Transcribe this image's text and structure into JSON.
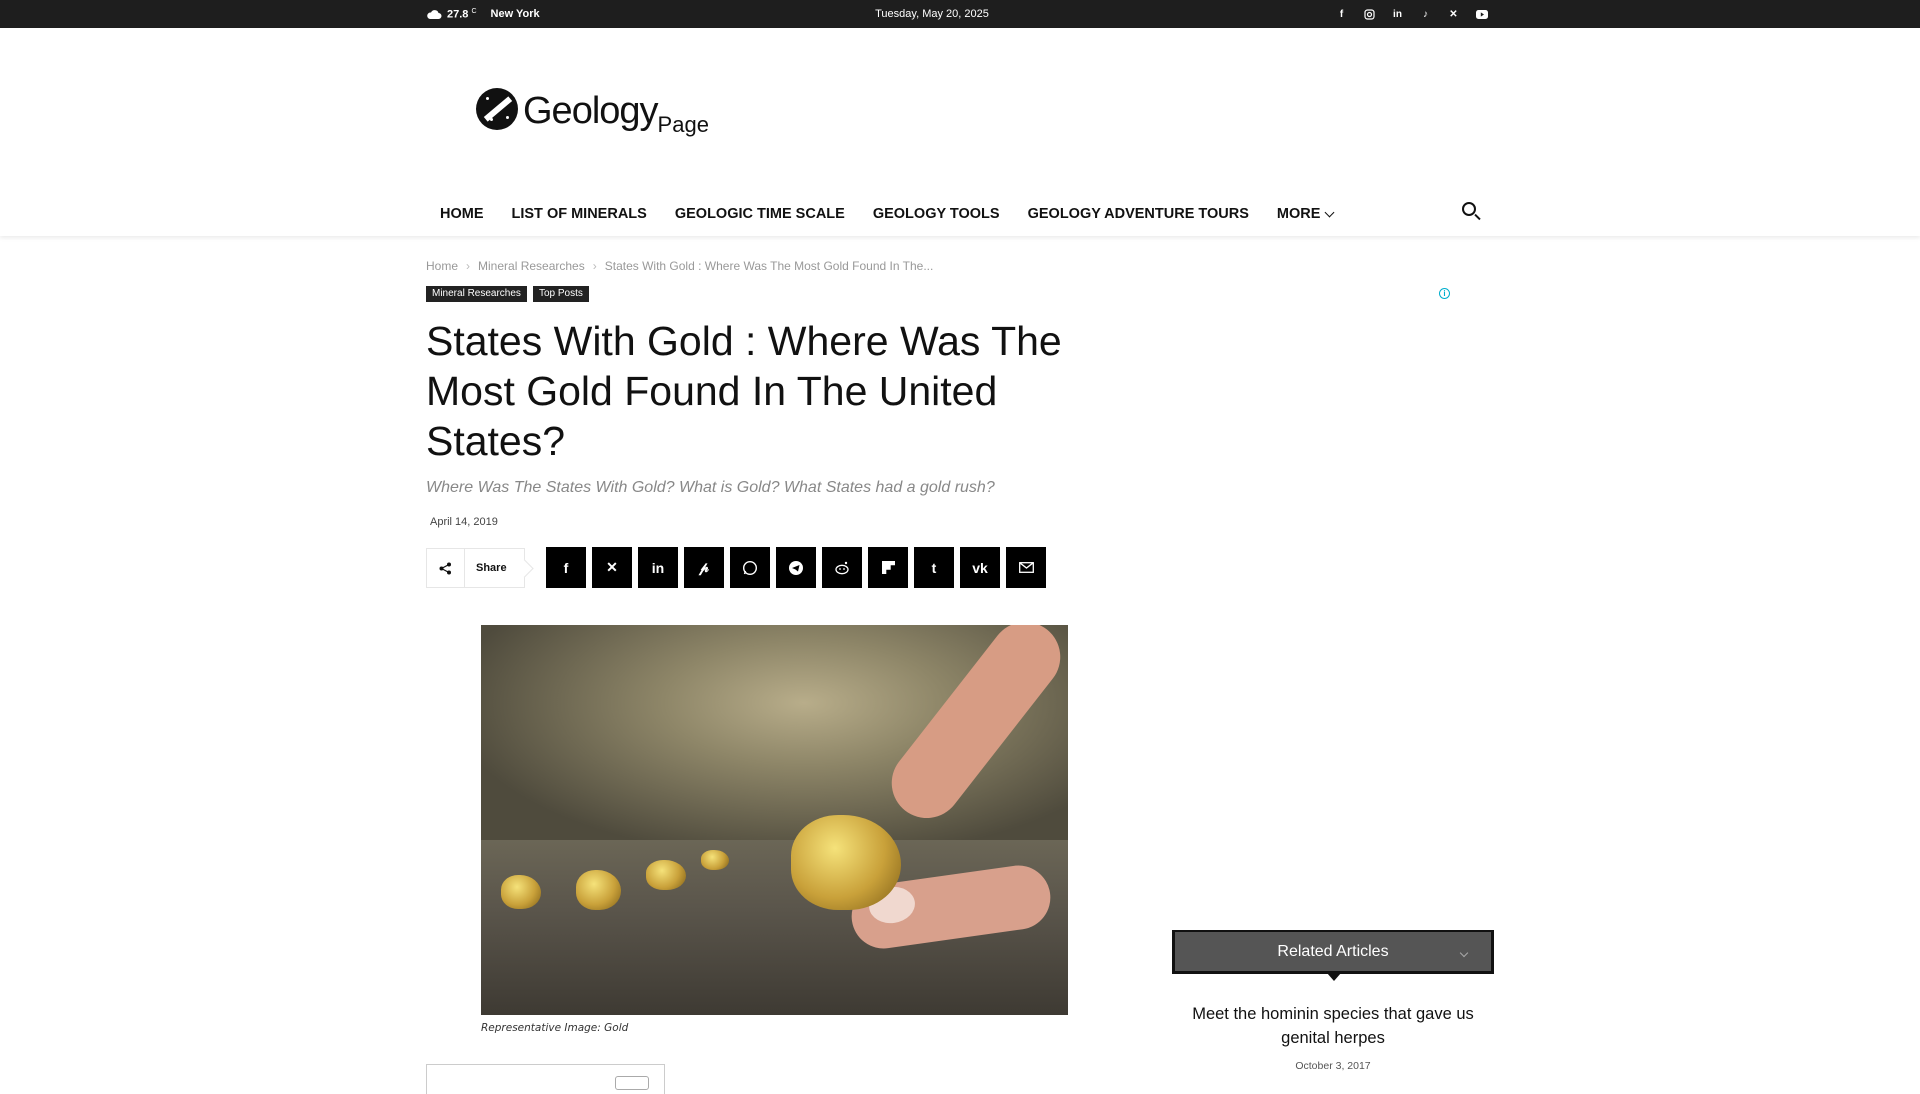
{
  "topbar": {
    "temperature": "27.8",
    "temp_unit": "C",
    "city": "New York",
    "date": "Tuesday, May 20, 2025",
    "socials": [
      "facebook-icon",
      "instagram-icon",
      "linkedin-icon",
      "tiktok-icon",
      "x-icon",
      "youtube-icon"
    ]
  },
  "logo": {
    "word": "Geology",
    "sub": "Page"
  },
  "nav": {
    "items": [
      {
        "label": "HOME"
      },
      {
        "label": "LIST OF MINERALS"
      },
      {
        "label": "GEOLOGIC TIME SCALE"
      },
      {
        "label": "GEOLOGY TOOLS"
      },
      {
        "label": "GEOLOGY ADVENTURE TOURS"
      },
      {
        "label": "MORE"
      }
    ]
  },
  "breadcrumb": {
    "home": "Home",
    "category": "Mineral Researches",
    "current": "States With Gold : Where Was The Most Gold Found In The..."
  },
  "tags": [
    "Mineral Researches",
    "Top Posts"
  ],
  "article": {
    "title": "States With Gold : Where Was The Most Gold Found In The United States?",
    "subtitle": "Where Was The States With Gold? What is Gold? What States had a gold rush?",
    "date": "April 14, 2019",
    "share_label": "Share",
    "share_buttons": [
      "facebook-icon",
      "x-icon",
      "linkedin-icon",
      "pinterest-icon",
      "whatsapp-icon",
      "telegram-icon",
      "reddit-icon",
      "flipboard-icon",
      "tumblr-icon",
      "vk-icon",
      "email-icon"
    ],
    "image_caption": "Representative Image: Gold"
  },
  "sidebar": {
    "related_header": "Related Articles",
    "related_title": "Meet the hominin species that gave us genital herpes",
    "related_date": "October 3, 2017"
  },
  "colors": {
    "topbar_bg": "#1e1e1e",
    "tag_bg": "#222222",
    "share_btn_bg": "#000000",
    "related_bg": "#555555",
    "ad_info": "#00aecd"
  }
}
